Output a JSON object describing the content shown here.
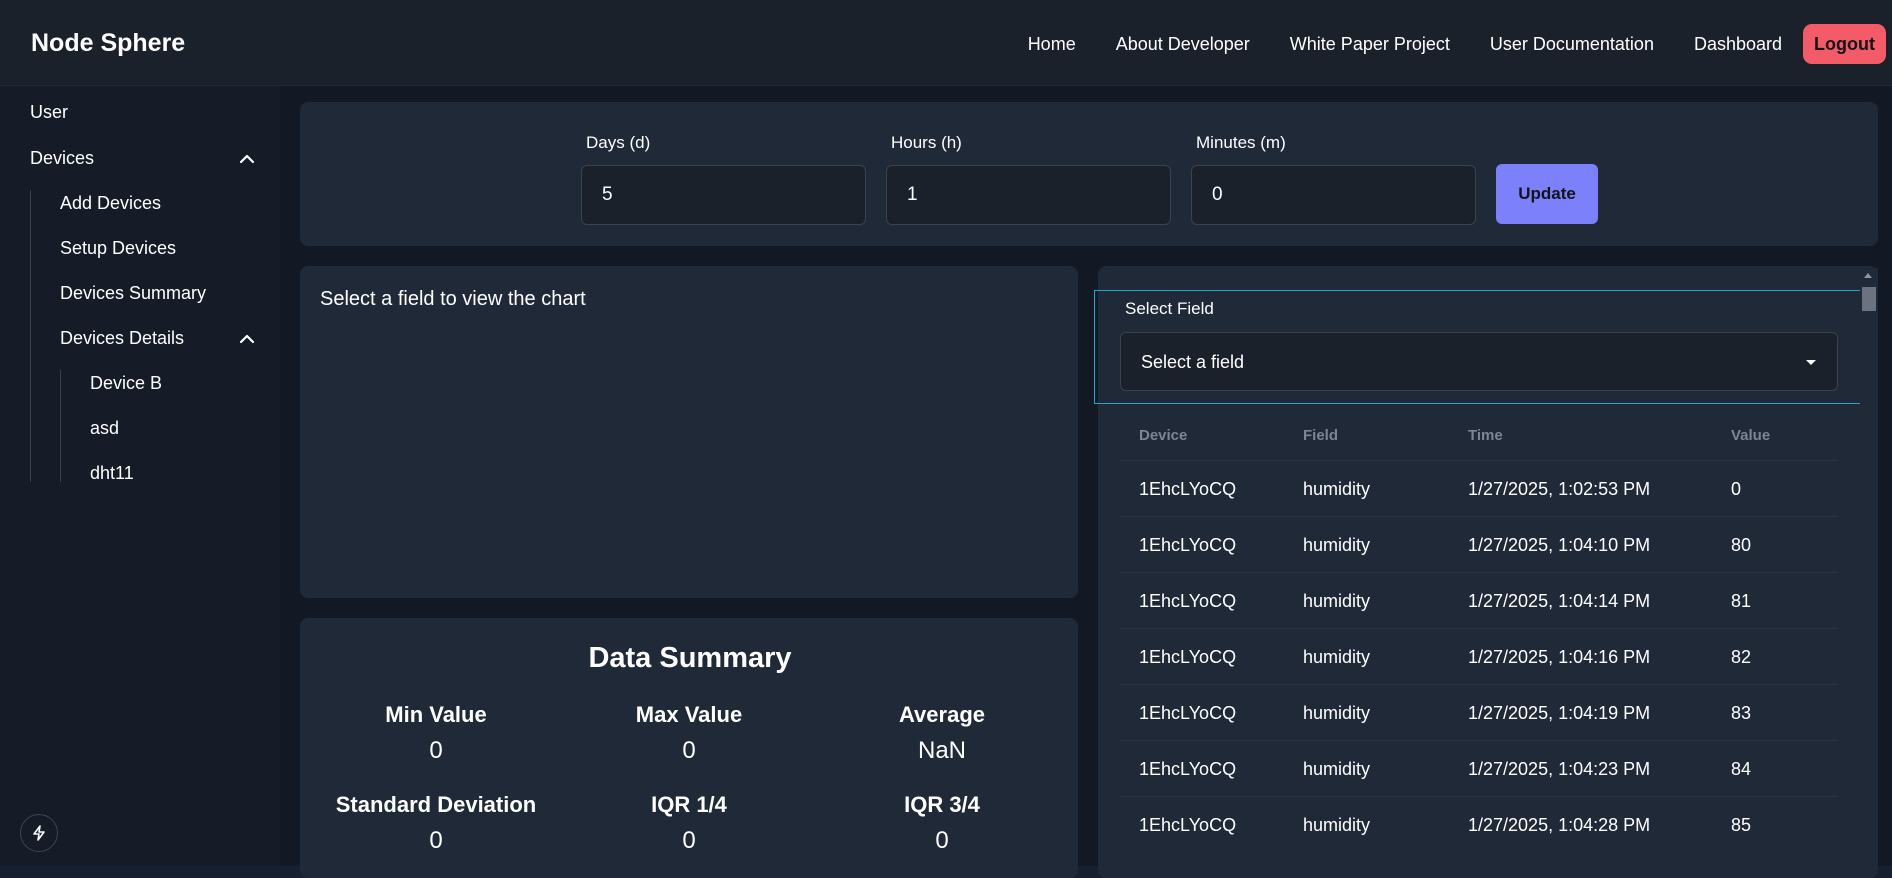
{
  "header": {
    "brand": "Node Sphere",
    "nav": [
      "Home",
      "About Developer",
      "White Paper Project",
      "User Documentation",
      "Dashboard"
    ],
    "logout_label": "Logout",
    "logout_color": "#f45b69"
  },
  "sidebar": {
    "user": "User",
    "devices": "Devices",
    "add_devices": "Add Devices",
    "setup_devices": "Setup Devices",
    "devices_summary": "Devices Summary",
    "devices_details": "Devices Details",
    "device_items": [
      "Device B",
      "asd",
      "dht11"
    ]
  },
  "time_range": {
    "days_label": "Days (d)",
    "days_value": "5",
    "hours_label": "Hours (h)",
    "hours_value": "1",
    "minutes_label": "Minutes (m)",
    "minutes_value": "0",
    "update_label": "Update",
    "update_color": "#7c80fb"
  },
  "chart_panel": {
    "message": "Select a field to view the chart"
  },
  "summary": {
    "title": "Data Summary",
    "stats": [
      {
        "label": "Min Value",
        "value": "0"
      },
      {
        "label": "Max Value",
        "value": "0"
      },
      {
        "label": "Average",
        "value": "NaN"
      },
      {
        "label": "Standard Deviation",
        "value": "0"
      },
      {
        "label": "IQR 1/4",
        "value": "0"
      },
      {
        "label": "IQR 3/4",
        "value": "0"
      }
    ]
  },
  "field_select": {
    "label": "Select Field",
    "value": "Select a field"
  },
  "table": {
    "headers": [
      "Device",
      "Field",
      "Time",
      "Value"
    ],
    "rows": [
      [
        "1EhcLYoCQ",
        "humidity",
        "1/27/2025, 1:02:53 PM",
        "0"
      ],
      [
        "1EhcLYoCQ",
        "humidity",
        "1/27/2025, 1:04:10 PM",
        "80"
      ],
      [
        "1EhcLYoCQ",
        "humidity",
        "1/27/2025, 1:04:14 PM",
        "81"
      ],
      [
        "1EhcLYoCQ",
        "humidity",
        "1/27/2025, 1:04:16 PM",
        "82"
      ],
      [
        "1EhcLYoCQ",
        "humidity",
        "1/27/2025, 1:04:19 PM",
        "83"
      ],
      [
        "1EhcLYoCQ",
        "humidity",
        "1/27/2025, 1:04:23 PM",
        "84"
      ],
      [
        "1EhcLYoCQ",
        "humidity",
        "1/27/2025, 1:04:28 PM",
        "85"
      ]
    ]
  },
  "icons": {
    "expand_devices": "chevron-up-icon",
    "expand_details": "chevron-up-icon",
    "select_caret": "caret-down-icon",
    "bottom_left": "lightning-icon"
  }
}
